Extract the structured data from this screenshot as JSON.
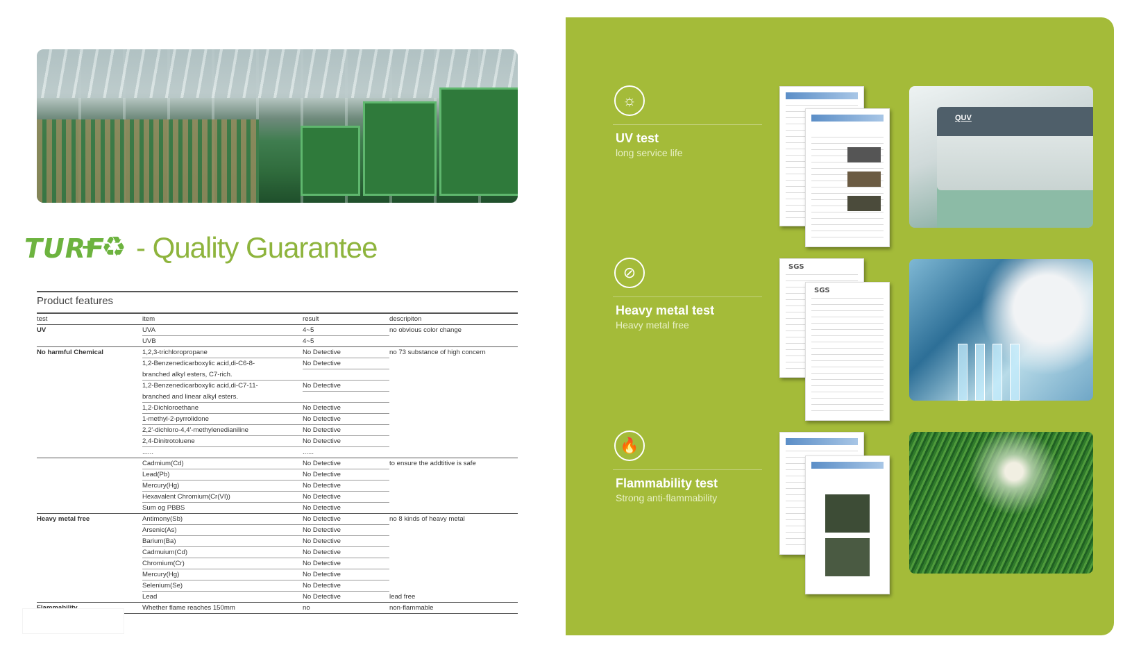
{
  "heading": {
    "logo_text": "TURF",
    "logo_plus": "+",
    "logo_icon": "recycle-icon",
    "title": "- Quality Guarantee"
  },
  "table": {
    "title": "Product features",
    "headers": [
      "test",
      "item",
      "result",
      "descripiton"
    ],
    "rows": [
      [
        "UV",
        "UVA",
        "4~5",
        "no obvious color change"
      ],
      [
        "",
        "UVB",
        "4~5",
        ""
      ],
      [
        "No harmful Chemical",
        "1,2,3-trichloropropane",
        "No Detective",
        "no 73 substance of high concern"
      ],
      [
        "",
        "1,2-Benzenedicarboxylic acid,di-C6-8-",
        "No Detective",
        ""
      ],
      [
        "",
        "branched alkyl esters, C7-rich.",
        "",
        ""
      ],
      [
        "",
        "1,2-Benzenedicarboxylic acid,di-C7-11-",
        "No Detective",
        ""
      ],
      [
        "",
        "branched and linear alkyl esters.",
        "",
        ""
      ],
      [
        "",
        "1,2-Dichloroethane",
        "No Detective",
        ""
      ],
      [
        "",
        "1-methyl-2-pyrrolidone",
        "No Detective",
        ""
      ],
      [
        "",
        "2,2'-dichloro-4,4'-methylenedianiline",
        "No Detective",
        ""
      ],
      [
        "",
        "2,4-Dinitrotoluene",
        "No Detective",
        ""
      ],
      [
        "",
        "......",
        "......",
        ""
      ],
      [
        "",
        "Cadmium(Cd)",
        "No Detective",
        "to ensure the addtitive is safe"
      ],
      [
        "",
        "Lead(Pb)",
        "No Detective",
        ""
      ],
      [
        "",
        "Mercury(Hg)",
        "No Detective",
        ""
      ],
      [
        "",
        "Hexavalent Chromium(Cr(VI))",
        "No Detective",
        ""
      ],
      [
        "",
        "Sum og PBBS",
        "No Detective",
        ""
      ],
      [
        "Heavy metal free",
        "Antimony(Sb)",
        "No Detective",
        "no 8 kinds of heavy metal"
      ],
      [
        "",
        "Arsenic(As)",
        "No Detective",
        ""
      ],
      [
        "",
        "Barium(Ba)",
        "No Detective",
        ""
      ],
      [
        "",
        "Cadmuium(Cd)",
        "No Detective",
        ""
      ],
      [
        "",
        "Chromium(Cr)",
        "No Detective",
        ""
      ],
      [
        "",
        "Mercury(Hg)",
        "No Detective",
        ""
      ],
      [
        "",
        "Selenium(Se)",
        "No Detective",
        ""
      ],
      [
        "",
        "Lead",
        "No Detective",
        "lead free"
      ],
      [
        "Flammability",
        "Whether flame reaches 150mm",
        "no",
        "non-flammable"
      ]
    ]
  },
  "tests": [
    {
      "title": "UV test",
      "subtitle": "long service life",
      "icon": "sun-icon",
      "doc_logo": "",
      "photo_text": "QUV"
    },
    {
      "title": "Heavy metal test",
      "subtitle": "Heavy metal free",
      "icon": "no-metal-icon",
      "doc_logo": "SGS"
    },
    {
      "title": "Flammability test",
      "subtitle": "Strong anti-flammability",
      "icon": "flame-icon",
      "doc_logo": ""
    }
  ],
  "colors": {
    "panel_green": "#a4bb39",
    "logo_green": "#6db33f",
    "heading_green": "#8eb43d"
  }
}
